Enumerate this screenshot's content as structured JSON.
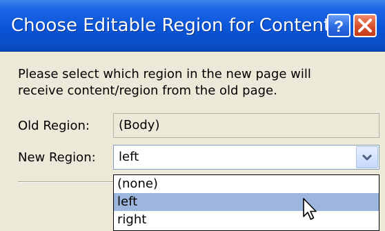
{
  "dialog": {
    "title": "Choose Editable Region for Content",
    "instructions_line1": "Please select which region in the new page will",
    "instructions_line2": "receive content/region from the old page.",
    "old_region_label": "Old Region:",
    "old_region_value": "(Body)",
    "new_region_label": "New Region:",
    "new_region_value": "left",
    "options": [
      "(none)",
      "left",
      "right"
    ],
    "selected_option": "left"
  },
  "icons": {
    "help": "help-question-icon",
    "close": "close-x-icon",
    "dropdown": "chevron-down-icon",
    "cursor": "mouse-pointer-icon"
  },
  "colors": {
    "titlebar": "#0a55d8",
    "dialog_bg": "#ece9d8",
    "selection": "#9db6dd",
    "close_button": "#d9502c"
  }
}
